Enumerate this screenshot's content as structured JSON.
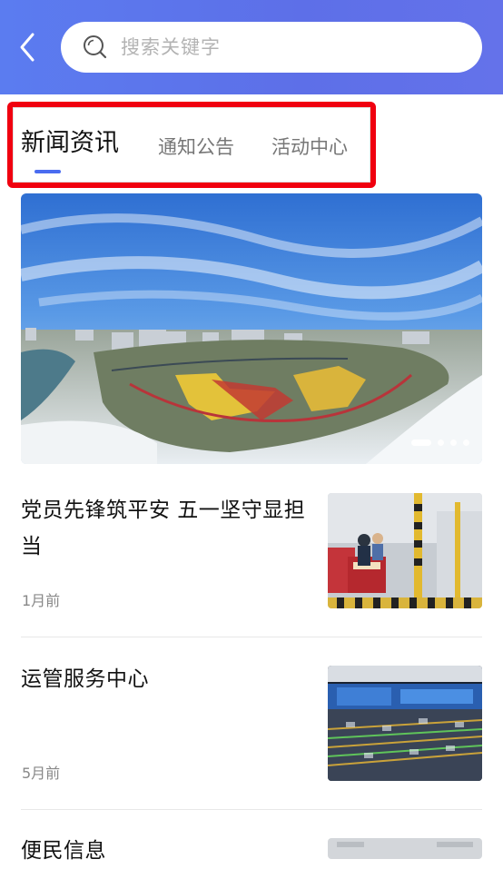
{
  "header": {
    "back_icon": "chevron-left-icon",
    "search_icon": "search-icon",
    "search_placeholder": "搜索关键字",
    "accent": "#5b7cf0"
  },
  "tabs": [
    {
      "label": "新闻资讯",
      "active": true
    },
    {
      "label": "通知公告",
      "active": false
    },
    {
      "label": "活动中心",
      "active": false
    }
  ],
  "highlight_color": "#f0000f",
  "banner": {
    "slides": 4,
    "active_slide": 1
  },
  "news": [
    {
      "title": "党员先锋筑平安  五一坚守显担当",
      "time": "1月前"
    },
    {
      "title": "运管服务中心",
      "time": "5月前"
    },
    {
      "title": "便民信息",
      "time": ""
    }
  ]
}
